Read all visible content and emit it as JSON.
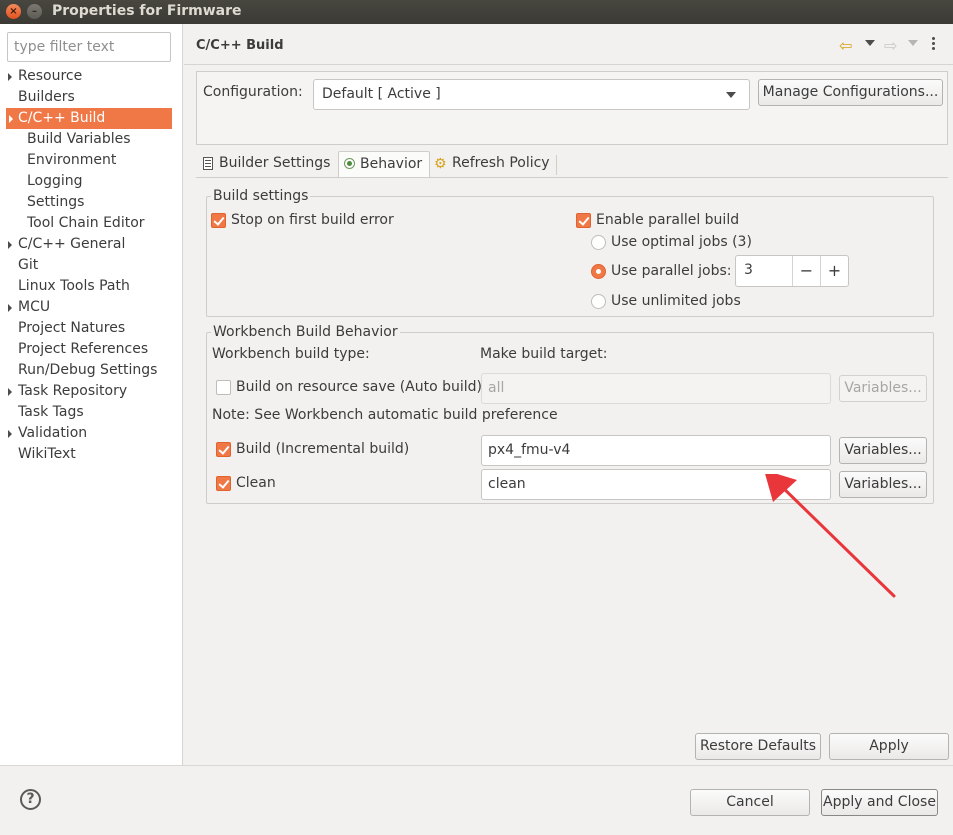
{
  "window": {
    "title": "Properties for Firmware",
    "close_glyph": "×",
    "min_glyph": "–"
  },
  "sidebar": {
    "filter_placeholder": "type filter text",
    "items": [
      {
        "label": "Resource",
        "expandable": true
      },
      {
        "label": "Builders",
        "expandable": false
      },
      {
        "label": "C/C++ Build",
        "expandable": true,
        "selected": true
      },
      {
        "label": "Build Variables",
        "child": true
      },
      {
        "label": "Environment",
        "child": true
      },
      {
        "label": "Logging",
        "child": true
      },
      {
        "label": "Settings",
        "child": true
      },
      {
        "label": "Tool Chain Editor",
        "child": true
      },
      {
        "label": "C/C++ General",
        "expandable": true
      },
      {
        "label": "Git",
        "expandable": false
      },
      {
        "label": "Linux Tools Path",
        "expandable": false
      },
      {
        "label": "MCU",
        "expandable": true
      },
      {
        "label": "Project Natures",
        "expandable": false
      },
      {
        "label": "Project References",
        "expandable": false
      },
      {
        "label": "Run/Debug Settings",
        "expandable": false
      },
      {
        "label": "Task Repository",
        "expandable": true
      },
      {
        "label": "Task Tags",
        "expandable": false
      },
      {
        "label": "Validation",
        "expandable": true
      },
      {
        "label": "WikiText",
        "expandable": false
      }
    ]
  },
  "page": {
    "title": "C/C++ Build",
    "nav": {
      "back_glyph": "⇦",
      "forward_glyph": "⇨"
    }
  },
  "configuration": {
    "label": "Configuration:",
    "value": "Default  [ Active ]",
    "manage_label": "Manage Configurations..."
  },
  "tabs": [
    {
      "label": "Builder Settings",
      "icon": "document-icon"
    },
    {
      "label": "Behavior",
      "icon": "radio-icon",
      "active": true
    },
    {
      "label": "Refresh Policy",
      "icon": "gear-icon",
      "glyph": "⚙"
    }
  ],
  "build_settings": {
    "title": "Build settings",
    "stop_on_error": {
      "label": "Stop on first build error",
      "checked": true
    },
    "parallel": {
      "label": "Enable parallel build",
      "checked": true
    },
    "optimal": {
      "label": "Use optimal jobs (3)",
      "selected": false
    },
    "parallel_jobs": {
      "label": "Use parallel jobs:",
      "selected": true,
      "value": "3",
      "minus": "−",
      "plus": "+"
    },
    "unlimited": {
      "label": "Use unlimited jobs",
      "selected": false
    }
  },
  "workbench": {
    "title": "Workbench Build Behavior",
    "type_header": "Workbench build type:",
    "target_header": "Make build target:",
    "auto_build": {
      "label": "Build on resource save (Auto build)",
      "checked": false,
      "target": "all",
      "enabled": false
    },
    "note": "Note: See Workbench automatic build preference",
    "incremental": {
      "label": "Build (Incremental build)",
      "checked": true,
      "target": "px4_fmu-v4"
    },
    "clean": {
      "label": "Clean",
      "checked": true,
      "target": "clean"
    },
    "variables_label": "Variables..."
  },
  "buttons": {
    "restore_defaults": "Restore Defaults",
    "apply": "Apply",
    "cancel": "Cancel",
    "apply_and_close": "Apply and Close",
    "help_glyph": "?"
  },
  "colors": {
    "accent": "#f07746",
    "annotation_arrow": "#e8363a"
  }
}
